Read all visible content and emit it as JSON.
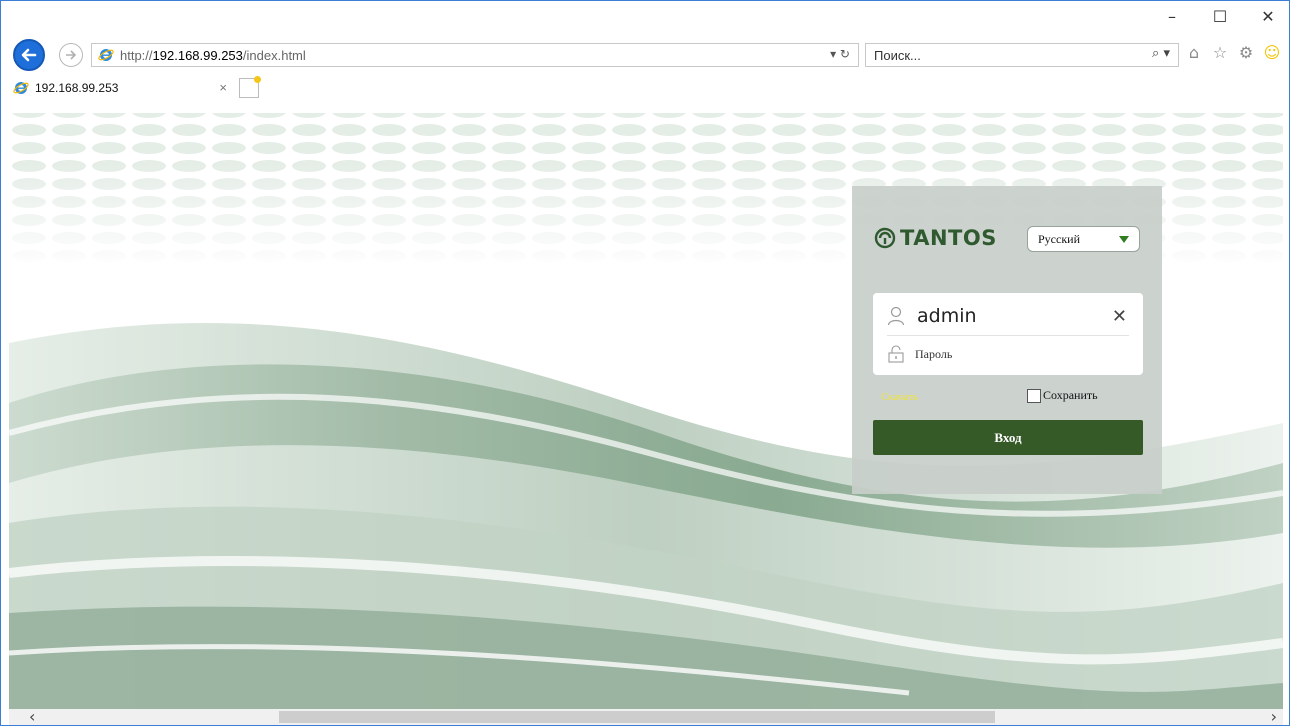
{
  "window": {
    "minimize_label": "–",
    "maximize_label": "☐",
    "close_label": "✕"
  },
  "browser": {
    "address": {
      "scheme": "http://",
      "domain": "192.168.99.253",
      "path": "/index.html",
      "tools": "▾ ↻"
    },
    "search": {
      "placeholder": "Поиск...",
      "tools": "⌕ ▾"
    },
    "tab": {
      "title": "192.168.99.253",
      "close_label": "×"
    },
    "toolbar": {
      "home_icon": "⌂",
      "favorites_icon": "☆",
      "settings_icon": "⚙",
      "feedback_icon": "☺"
    }
  },
  "login": {
    "logo_text": "TANTOS",
    "language": "Русский",
    "username": "admin",
    "password_placeholder": "Пароль",
    "clear_label": "✕",
    "download_label": "Скачать",
    "remember_label": "Сохранить",
    "login_button": "Вход"
  },
  "scrollbar": {
    "left_arrow": "‹",
    "right_arrow": "›"
  },
  "colors": {
    "accent": "#1e6fd9",
    "login_button": "#355a28",
    "logo": "#2f5a2f",
    "download_link": "#f0e43a",
    "panel": "#c8ceca"
  }
}
